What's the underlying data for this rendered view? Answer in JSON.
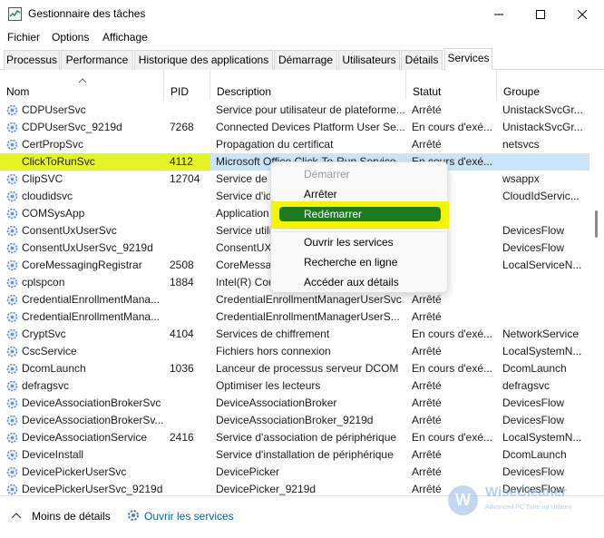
{
  "window": {
    "title": "Gestionnaire des tâches"
  },
  "menu": [
    "Fichier",
    "Options",
    "Affichage"
  ],
  "tabs": [
    "Processus",
    "Performance",
    "Historique des applications",
    "Démarrage",
    "Utilisateurs",
    "Détails",
    "Services"
  ],
  "active_tab": "Services",
  "columns": {
    "name": "Nom",
    "pid": "PID",
    "description": "Description",
    "status": "Statut",
    "group": "Groupe"
  },
  "services": [
    {
      "name": "CDPUserSvc",
      "pid": "",
      "desc": "Service pour utilisateur de plateforme...",
      "status": "Arrêté",
      "group": "UnistackSvcGr..."
    },
    {
      "name": "CDPUserSvc_9219d",
      "pid": "7268",
      "desc": "Connected Devices Platform User Se...",
      "status": "En cours d'exé...",
      "group": "UnistackSvcGr..."
    },
    {
      "name": "CertPropSvc",
      "pid": "",
      "desc": "Propagation du certificat",
      "status": "Arrêté",
      "group": "netsvcs"
    },
    {
      "name": "ClickToRunSvc",
      "pid": "4112",
      "desc": "Microsoft Office Click-To-Run Service",
      "status": "En cours d'exé...",
      "group": ""
    },
    {
      "name": "ClipSVC",
      "pid": "12704",
      "desc": "Service de l'",
      "status": "",
      "group": "wsappx"
    },
    {
      "name": "cloudidsvc",
      "pid": "",
      "desc": "Service d'id",
      "status": "",
      "group": "CloudIdServic..."
    },
    {
      "name": "COMSysApp",
      "pid": "",
      "desc": "Application",
      "status": "",
      "group": ""
    },
    {
      "name": "ConsentUxUserSvc",
      "pid": "",
      "desc": "Service utili",
      "status": "",
      "group": "DevicesFlow"
    },
    {
      "name": "ConsentUxUserSvc_9219d",
      "pid": "",
      "desc": "ConsentUX",
      "status": "",
      "group": "DevicesFlow"
    },
    {
      "name": "CoreMessagingRegistrar",
      "pid": "2508",
      "desc": "CoreMessa",
      "status": "",
      "group": "LocalServiceN..."
    },
    {
      "name": "cplspcon",
      "pid": "1884",
      "desc": "Intel(R) Cor",
      "status": "",
      "group": ""
    },
    {
      "name": "CredentialEnrollmentMana...",
      "pid": "",
      "desc": "CredentialEnrollmentManagerUserSvc",
      "status": "Arrêté",
      "group": ""
    },
    {
      "name": "CredentialEnrollmentMana...",
      "pid": "",
      "desc": "CredentialEnrollmentManagerUserS...",
      "status": "Arrêté",
      "group": ""
    },
    {
      "name": "CryptSvc",
      "pid": "4104",
      "desc": "Services de chiffrement",
      "status": "En cours d'exé...",
      "group": "NetworkService"
    },
    {
      "name": "CscService",
      "pid": "",
      "desc": "Fichiers hors connexion",
      "status": "Arrêté",
      "group": "LocalSystemN..."
    },
    {
      "name": "DcomLaunch",
      "pid": "1036",
      "desc": "Lanceur de processus serveur DCOM",
      "status": "En cours d'exé...",
      "group": "DcomLaunch"
    },
    {
      "name": "defragsvc",
      "pid": "",
      "desc": "Optimiser les lecteurs",
      "status": "Arrêté",
      "group": "defragsvc"
    },
    {
      "name": "DeviceAssociationBrokerSvc",
      "pid": "",
      "desc": "DeviceAssociationBroker",
      "status": "Arrêté",
      "group": "DevicesFlow"
    },
    {
      "name": "DeviceAssociationBrokerSv...",
      "pid": "",
      "desc": "DeviceAssociationBroker_9219d",
      "status": "Arrêté",
      "group": "DevicesFlow"
    },
    {
      "name": "DeviceAssociationService",
      "pid": "2416",
      "desc": "Service d'association de périphérique",
      "status": "En cours d'exé...",
      "group": "LocalSystemN..."
    },
    {
      "name": "DeviceInstall",
      "pid": "",
      "desc": "Service d'installation de périphérique",
      "status": "Arrêté",
      "group": "DcomLaunch"
    },
    {
      "name": "DevicePickerUserSvc",
      "pid": "",
      "desc": "DevicePicker",
      "status": "Arrêté",
      "group": "DevicesFlow"
    },
    {
      "name": "DevicePickerUserSvc_9219d",
      "pid": "",
      "desc": "DevicePicker_9219d",
      "status": "Arrêté",
      "group": "DevicesFlow"
    }
  ],
  "selected_row": 3,
  "context_menu": {
    "start": "Démarrer",
    "stop": "Arrêter",
    "restart": "Redémarrer",
    "open_services": "Ouvrir les services",
    "search_online": "Recherche en ligne",
    "go_to_details": "Accéder aux détails"
  },
  "footer": {
    "less_details": "Moins de détails",
    "open_services": "Ouvrir les services"
  },
  "watermark": {
    "title": "WiseCleaner",
    "subtitle": "Advanced PC Tune-up Utilities",
    "logo_letter": "W"
  },
  "colors": {
    "highlight_yellow": "#e4f523",
    "selected_row": "#cce4f7",
    "restart_green": "#1e7a1e",
    "link_blue": "#0063b1"
  }
}
